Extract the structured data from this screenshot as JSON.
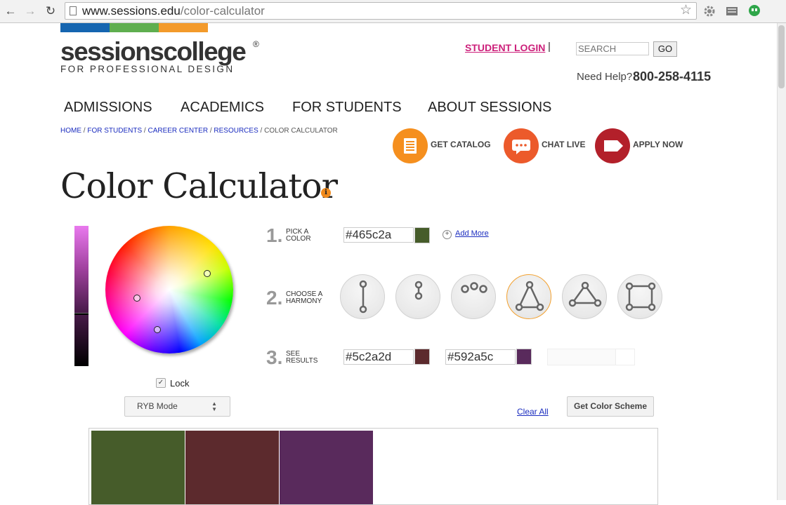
{
  "browser": {
    "url_host": "www.sessions.edu",
    "url_path": "/color-calculator",
    "back_icon": "←",
    "forward_icon": "→",
    "reload_icon": "↻",
    "star_icon": "☆"
  },
  "logo": {
    "name": "sessionscollege",
    "registered": "®",
    "tagline": "FOR PROFESSIONAL DESIGN",
    "stripe_colors": [
      "#1565b0",
      "#5fae4f",
      "#f39a2b"
    ]
  },
  "header": {
    "student_login": "STUDENT LOGIN",
    "separator": "|",
    "search_placeholder": "SEARCH",
    "go_label": "GO",
    "help_label": "Need Help?",
    "help_phone": "800-258-4115"
  },
  "nav": {
    "items": [
      "ADMISSIONS",
      "ACADEMICS",
      "FOR STUDENTS",
      "ABOUT SESSIONS"
    ]
  },
  "breadcrumb": {
    "items": [
      "HOME",
      "FOR STUDENTS",
      "CAREER CENTER",
      "RESOURCES"
    ],
    "current": "COLOR CALCULATOR",
    "separator": " / "
  },
  "cta": {
    "catalog": "GET CATALOG",
    "chat": "CHAT LIVE",
    "apply": "APPLY NOW",
    "colors": {
      "catalog": "#f58f1e",
      "chat": "#ec5a2b",
      "apply": "#b3202a"
    }
  },
  "page": {
    "title": "Color Calculator",
    "info_icon": "i"
  },
  "calculator": {
    "lock_label": "Lock",
    "lock_check": "✓",
    "mode_label": "RYB Mode",
    "step1": {
      "num": "1.",
      "line1": "PICK A",
      "line2": "COLOR",
      "hex": "#465c2a",
      "swatch": "#465c2a",
      "add_more": "Add More",
      "add_icon": "+"
    },
    "step2": {
      "num": "2.",
      "line1": "CHOOSE A",
      "line2": "HARMONY",
      "selected": "triad"
    },
    "step3": {
      "num": "3.",
      "line1": "SEE",
      "line2": "RESULTS",
      "results": [
        {
          "hex": "#5c2a2d",
          "swatch": "#5c2a2d"
        },
        {
          "hex": "#592a5c",
          "swatch": "#592a5c"
        }
      ]
    },
    "clear_all": "Clear All",
    "get_scheme": "Get Color Scheme"
  },
  "scheme": {
    "colors": [
      "#465c2a",
      "#5c2a2d",
      "#592a5c"
    ]
  }
}
